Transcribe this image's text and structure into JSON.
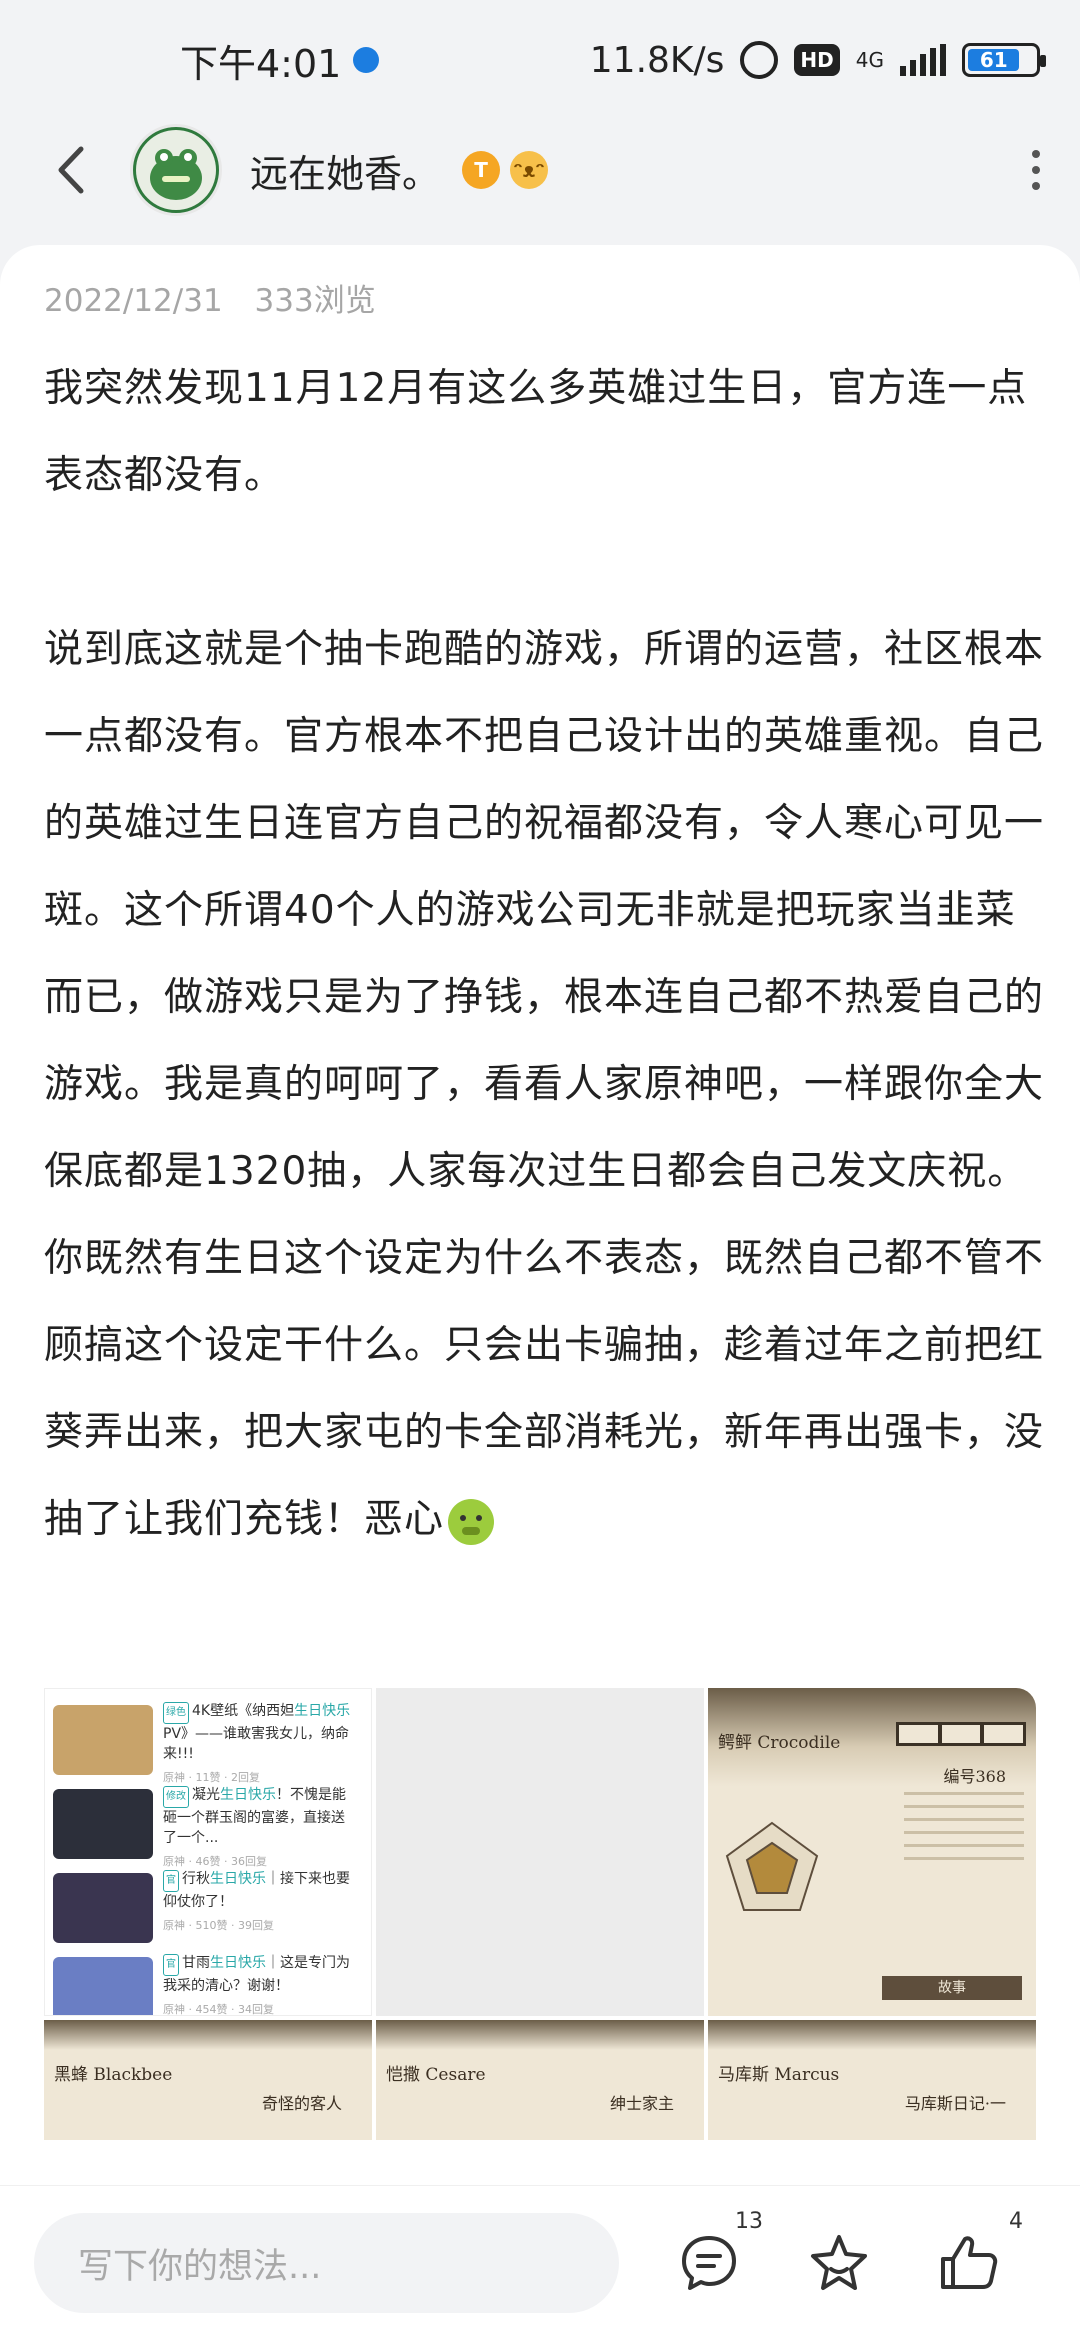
{
  "status_bar": {
    "time": "下午4:01",
    "net_speed": "11.8K/s",
    "hd": "HD",
    "network": "4G",
    "battery": "61"
  },
  "header": {
    "username": "远在她香。",
    "badge_t": "T",
    "badge_face": "ᵔᴥᵔ"
  },
  "post": {
    "date": "2022/12/31",
    "views": "333浏览",
    "paragraph_1": "我突然发现11月12月有这么多英雄过生日，官方连一点表态都没有。",
    "paragraph_2": "说到底这就是个抽卡跑酷的游戏，所谓的运营，社区根本一点都没有。官方根本不把自己设计出的英雄重视。自己的英雄过生日连官方自己的祝福都没有，令人寒心可见一斑。这个所谓40个人的游戏公司无非就是把玩家当韭菜而已，做游戏只是为了挣钱，根本连自己都不热爱自己的游戏。我是真的呵呵了，看看人家原神吧，一样跟你全大保底都是1320抽，人家每次过生日都会自己发文庆祝。你既然有生日这个设定为什么不表态，既然自己都不管不顾搞这个设定干什么。只会出卡骗抽，趁着过年之前把红葵弄出来，把大家屯的卡全部消耗光，新年再出强卡，没抽了让我们充钱！恶心",
    "emoji": "nauseated-face"
  },
  "image_grid": {
    "list_items": [
      {
        "tag": "绿色",
        "title_pre": "4K壁纸《纳西妲",
        "highlight": "生日快乐",
        "title_post": "PV》——谁敢害我女儿，纳命来!!!",
        "meta": "原神 · 11赞 · 2回复",
        "thumb": "#c8a36a"
      },
      {
        "tag": "修改",
        "title_pre": "凝光",
        "highlight": "生日快乐",
        "title_post": "！不愧是能砸一个群玉阁的富婆，直接送了一个...",
        "meta": "原神 · 46赞 · 36回复",
        "thumb": "#2c2f3a"
      },
      {
        "tag": "官",
        "title_pre": "行秋",
        "highlight": "生日快乐",
        "title_post": "｜接下来也要仰仗你了！",
        "meta": "原神 · 510赞 · 39回复",
        "thumb": "#3a3550"
      },
      {
        "tag": "官",
        "title_pre": "甘雨",
        "highlight": "生日快乐",
        "title_post": "｜这是专门为我采的清心？谢谢！",
        "meta": "原神 · 454赞 · 34回复",
        "thumb": "#6a7ec4"
      }
    ],
    "cards": [
      {
        "name": "鳄鲆 Crocodile",
        "title": "编号368",
        "button": "故事"
      },
      {
        "name": "黑蜂 Blackbee",
        "title": "奇怪的客人",
        "button": ""
      },
      {
        "name": "恺撒 Cesare",
        "title": "绅士家主",
        "button": ""
      },
      {
        "name": "马库斯 Marcus",
        "title": "马库斯日记·一",
        "button": ""
      }
    ]
  },
  "bottom_bar": {
    "input_placeholder": "写下你的想法...",
    "comment_count": "13",
    "like_count": "4"
  },
  "colors": {
    "accent": "#1c7de0",
    "teal_highlight": "#2aa8a8",
    "meta_gray": "#a6a6a6"
  }
}
